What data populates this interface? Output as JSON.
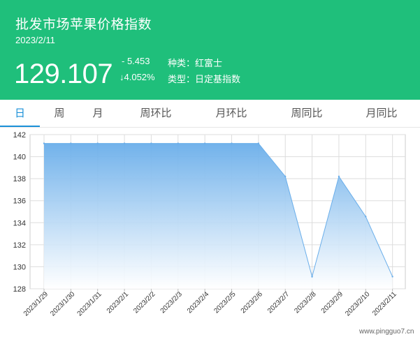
{
  "header": {
    "title": "批发市场苹果价格指数",
    "date": "2023/2/11",
    "price": "129.107",
    "change": "- 5.453",
    "change_pct": "↓4.052%",
    "variety": "种类：红富士",
    "index_type": "类型：日定基指数"
  },
  "tabs": [
    {
      "label": "日",
      "active": true
    },
    {
      "label": "周",
      "active": false
    },
    {
      "label": "月",
      "active": false
    },
    {
      "label": "周环比",
      "active": false
    },
    {
      "label": "月环比",
      "active": false
    },
    {
      "label": "周同比",
      "active": false
    },
    {
      "label": "月同比",
      "active": false
    }
  ],
  "colors": {
    "header_bg": "#1fbf7b",
    "active_tab": "#1a90d8",
    "area_top": "#6aaeea",
    "area_bottom": "#ffffff",
    "line": "#6aaeea"
  },
  "watermark": "www.pingguo7.cn",
  "chart_data": {
    "type": "area",
    "categories": [
      "2023/1/29",
      "2023/1/30",
      "2023/1/31",
      "2023/2/1",
      "2023/2/2",
      "2023/2/3",
      "2023/2/4",
      "2023/2/5",
      "2023/2/6",
      "2023/2/7",
      "2023/2/8",
      "2023/2/9",
      "2023/2/10",
      "2023/2/11"
    ],
    "values": [
      141.2,
      141.2,
      141.2,
      141.2,
      141.2,
      141.2,
      141.2,
      141.2,
      141.2,
      138.2,
      129.1,
      138.2,
      134.56,
      129.107
    ],
    "ylim": [
      128,
      142
    ],
    "yticks": [
      128,
      130,
      132,
      134,
      136,
      138,
      140,
      142
    ],
    "grid": true
  }
}
